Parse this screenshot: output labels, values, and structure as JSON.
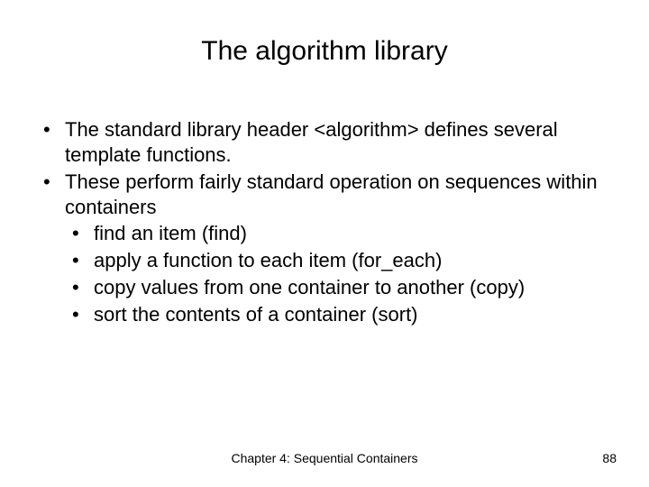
{
  "title": "The algorithm library",
  "bullets": {
    "b1": "The standard library header <algorithm> defines several template functions.",
    "b2": "These perform fairly standard operation on sequences within containers",
    "sub": {
      "s1": "find an item (find)",
      "s2": "apply a function to each item (for_each)",
      "s3": "copy values from one container to another (copy)",
      "s4": "sort the contents of a container (sort)"
    }
  },
  "footer": {
    "chapter": "Chapter 4: Sequential Containers",
    "page": "88"
  }
}
